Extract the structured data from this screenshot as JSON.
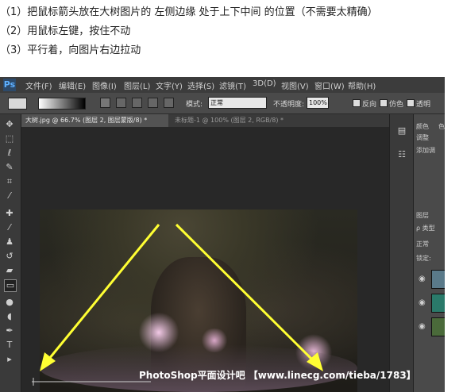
{
  "instructions": [
    "（1）把鼠标箭头放在大树图片的 左侧边缘 处于上下中间 的位置（不需要太精确）",
    "（2）用鼠标左键，按住不动",
    "（3）平行着，向图片右边拉动"
  ],
  "app": {
    "logo": "Ps"
  },
  "menu": [
    "文件(F)",
    "编辑(E)",
    "图像(I)",
    "图层(L)",
    "文字(Y)",
    "选择(S)",
    "滤镜(T)",
    "3D(D)",
    "视图(V)",
    "窗口(W)",
    "帮助(H)"
  ],
  "options": {
    "mode_label": "模式:",
    "mode_value": "正常",
    "opacity_label": "不透明度:",
    "opacity_value": "100%",
    "reverse_label": "反向",
    "dither_label": "仿色",
    "transparency_label": "透明"
  },
  "tabs": [
    {
      "label": "大树.jpg @ 66.7% (图层 2, 图层蒙版/8) *",
      "active": true
    },
    {
      "label": "未标题-1 @ 100% (图层 2, RGB/8) *",
      "active": false
    }
  ],
  "tools": [
    "move-tool",
    "marquee-tool",
    "lasso-tool",
    "quick-select-tool",
    "crop-tool",
    "eyedropper-tool",
    "healing-tool",
    "brush-tool",
    "stamp-tool",
    "history-brush-tool",
    "eraser-tool",
    "gradient-tool",
    "blur-tool",
    "dodge-tool",
    "pen-tool",
    "type-tool",
    "path-select-tool"
  ],
  "panels": {
    "color_tab": "颜色",
    "swatches_tab": "色",
    "adjust_tab": "调整",
    "add_adjust": "添加调",
    "layers_tab": "图层",
    "kind_label": "ρ 类型",
    "blend_mode": "正常",
    "lock_label": "锁定:"
  },
  "watermark": "PhotoShop平面设计吧 【www.linecg.com/tieba/1783】",
  "colors": {
    "arrow": "#ffff33",
    "ps_bg": "#2b2b2b",
    "active_tab": "#535353"
  }
}
